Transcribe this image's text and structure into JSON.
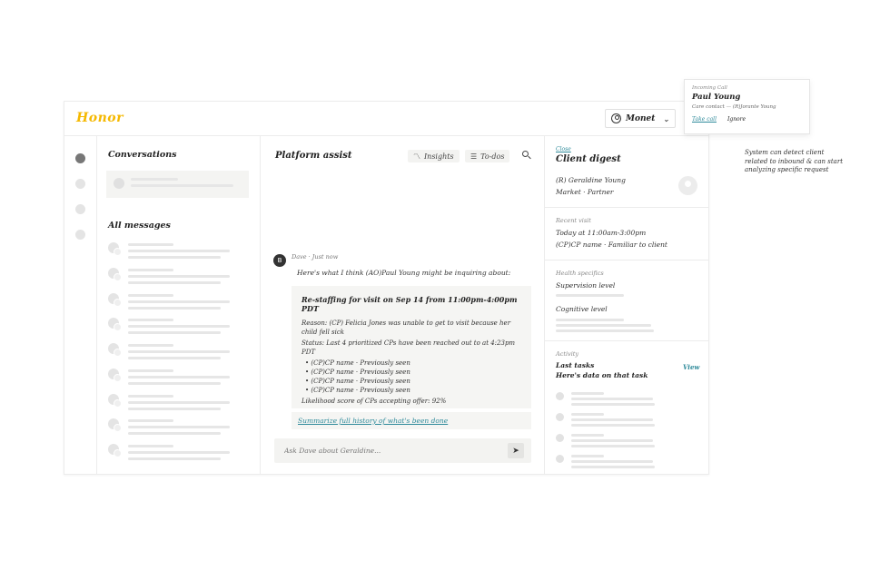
{
  "app": {
    "logo": "Honor",
    "user": {
      "name": "Monet",
      "icon": "user-circle-icon",
      "chevron": "chevron-down-icon"
    }
  },
  "conversations": {
    "title": "Conversations",
    "all_messages_title": "All messages"
  },
  "assist": {
    "title": "Platform assist",
    "tabs": [
      {
        "label": "Insights",
        "icon": "insights-icon"
      },
      {
        "label": "To-dos",
        "icon": "list-icon"
      }
    ],
    "message": {
      "author_meta": "Dave · Just now",
      "avatar_letter": "B",
      "intro": "Here's what I think (AO)Paul Young might be inquiring about:",
      "card": {
        "title": "Re-staffing for visit on Sep 14 from 11:00pm-4:00pm PDT",
        "reason": "Reason: (CP) Felicia Jones was unable to get to visit because her child fell sick",
        "status": "Status: Last 4 prioritized CPs have been reached out to at 4:23pm PDT",
        "cps": [
          "(CP)CP name · Previously seen",
          "(CP)CP name · Previously seen",
          "(CP)CP name · Previously seen",
          "(CP)CP name · Previously seen"
        ],
        "likelihood": "Likelihood score of CPs accepting offer: 92%"
      },
      "summary_link": "Summarize full history of what's been done"
    },
    "input": {
      "placeholder": "Ask Dave about Geraldine..."
    }
  },
  "digest": {
    "close": "Close",
    "title": "Client digest",
    "client_name": "(R) Geraldine Young",
    "client_market": "Market · Partner",
    "recent_visit_label": "Recent visit",
    "recent_visit_time": "Today at 11:00am-3:00pm",
    "recent_visit_cp": "(CP)CP name · Familiar to client",
    "health_label": "Health specifics",
    "supervision": "Supervision level",
    "cognitive": "Cognitive level",
    "activity_label": "Activity",
    "last_tasks": "Last tasks",
    "view": "View",
    "tasks_data": "Here's data on that task"
  },
  "incoming_call": {
    "label": "Incoming Call",
    "name": "Paul Young",
    "subtitle": "Care contact — (R)Jorante Young",
    "take": "Take call",
    "ignore": "Ignore"
  },
  "annotation": "System can detect client related to inbound & can start analyzing specific request",
  "colors": {
    "accent": "#2e8a9a",
    "brand": "#f5b800"
  }
}
